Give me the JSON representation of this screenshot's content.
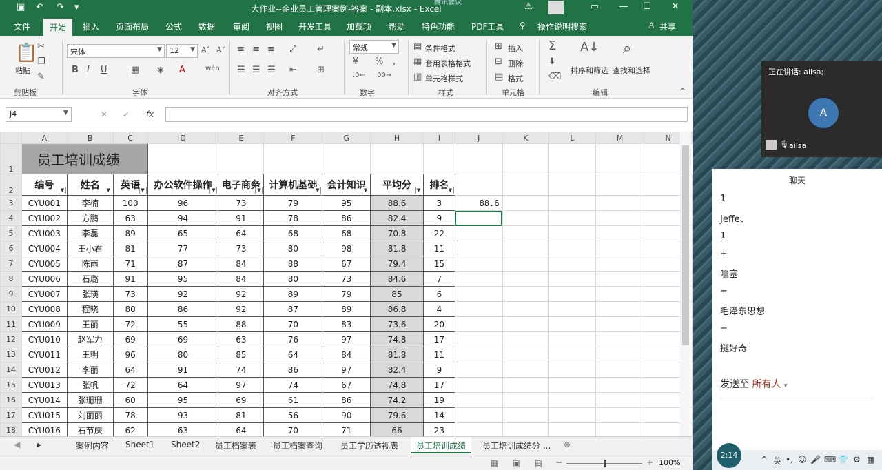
{
  "window": {
    "title": "大作业--企业员工管理案例-答案 - 副本.xlsx - Excel",
    "overlay_label": "腾讯会议"
  },
  "ribbon_tabs": [
    "文件",
    "开始",
    "插入",
    "页面布局",
    "公式",
    "数据",
    "审阅",
    "视图",
    "开发工具",
    "加载项",
    "帮助",
    "特色功能",
    "PDF工具"
  ],
  "active_tab": "开始",
  "tell_me": "操作说明搜索",
  "share_label": "共享",
  "ribbon": {
    "clipboard": {
      "label": "剪贴板",
      "paste": "粘贴"
    },
    "font": {
      "label": "字体",
      "name": "宋体",
      "size": "12"
    },
    "alignment": {
      "label": "对齐方式"
    },
    "number": {
      "label": "数字",
      "format": "常规"
    },
    "styles": {
      "label": "样式",
      "conditional": "条件格式",
      "table": "套用表格格式",
      "cell": "单元格样式"
    },
    "cells": {
      "label": "单元格",
      "insert": "插入",
      "delete": "删除",
      "format": "格式"
    },
    "editing": {
      "label": "编辑",
      "sort": "排序和筛选",
      "find": "查找和选择"
    }
  },
  "formula_bar": {
    "name_box": "J4",
    "value": ""
  },
  "columns": [
    "A",
    "B",
    "C",
    "D",
    "E",
    "F",
    "G",
    "H",
    "I",
    "J",
    "K",
    "L",
    "M",
    "N"
  ],
  "sheet": {
    "title": "员工培训成绩",
    "headers": [
      "编号",
      "姓名",
      "英语",
      "办公软件操作",
      "电子商务",
      "计算机基础",
      "会计知识",
      "平均分",
      "排名"
    ],
    "rows": [
      {
        "num": "3",
        "cells": [
          "CYU001",
          "李楠",
          "100",
          "96",
          "73",
          "79",
          "95",
          "88.6",
          "3"
        ]
      },
      {
        "num": "4",
        "cells": [
          "CYU002",
          "方鹏",
          "63",
          "94",
          "91",
          "78",
          "86",
          "82.4",
          "9"
        ]
      },
      {
        "num": "5",
        "cells": [
          "CYU003",
          "李磊",
          "89",
          "65",
          "64",
          "68",
          "68",
          "70.8",
          "22"
        ]
      },
      {
        "num": "6",
        "cells": [
          "CYU004",
          "王小君",
          "81",
          "77",
          "73",
          "80",
          "98",
          "81.8",
          "11"
        ]
      },
      {
        "num": "7",
        "cells": [
          "CYU005",
          "陈雨",
          "71",
          "87",
          "84",
          "88",
          "67",
          "79.4",
          "15"
        ]
      },
      {
        "num": "8",
        "cells": [
          "CYU006",
          "石璐",
          "91",
          "95",
          "84",
          "80",
          "73",
          "84.6",
          "7"
        ]
      },
      {
        "num": "9",
        "cells": [
          "CYU007",
          "张瑛",
          "73",
          "92",
          "92",
          "89",
          "79",
          "85",
          "6"
        ]
      },
      {
        "num": "10",
        "cells": [
          "CYU008",
          "程晓",
          "80",
          "86",
          "92",
          "87",
          "89",
          "86.8",
          "4"
        ]
      },
      {
        "num": "11",
        "cells": [
          "CYU009",
          "王丽",
          "72",
          "55",
          "88",
          "70",
          "83",
          "73.6",
          "20"
        ]
      },
      {
        "num": "12",
        "cells": [
          "CYU010",
          "赵军力",
          "69",
          "69",
          "63",
          "76",
          "97",
          "74.8",
          "17"
        ]
      },
      {
        "num": "13",
        "cells": [
          "CYU011",
          "王明",
          "96",
          "80",
          "85",
          "64",
          "84",
          "81.8",
          "11"
        ]
      },
      {
        "num": "14",
        "cells": [
          "CYU012",
          "李丽",
          "64",
          "91",
          "74",
          "86",
          "97",
          "82.4",
          "9"
        ]
      },
      {
        "num": "15",
        "cells": [
          "CYU013",
          "张帆",
          "72",
          "64",
          "97",
          "74",
          "67",
          "74.8",
          "17"
        ]
      },
      {
        "num": "16",
        "cells": [
          "CYU014",
          "张珊珊",
          "60",
          "95",
          "69",
          "61",
          "86",
          "74.2",
          "19"
        ]
      },
      {
        "num": "17",
        "cells": [
          "CYU015",
          "刘丽丽",
          "78",
          "93",
          "81",
          "56",
          "90",
          "79.6",
          "14"
        ]
      },
      {
        "num": "18",
        "cells": [
          "CYU016",
          "石节庆",
          "62",
          "63",
          "64",
          "70",
          "71",
          "66",
          "23"
        ]
      }
    ],
    "j3_value": "88.6"
  },
  "sheet_tabs": [
    "案例内容",
    "Sheet1",
    "Sheet2",
    "员工档案表",
    "员工档案查询",
    "员工学历透视表",
    "员工培训成绩",
    "员工培训成绩分 ..."
  ],
  "active_sheet": "员工培训成绩",
  "zoom": "100%",
  "meeting": {
    "speaking": "正在讲话: ailsa;",
    "avatar_letter": "A",
    "speaker": "ailsa",
    "chat_title": "聊天",
    "messages": [
      "1",
      "Jeffe、",
      "1",
      "+",
      "哇塞",
      "+",
      "毛泽东思想",
      "+",
      "挺好奇"
    ],
    "send_to_label": "发送至",
    "send_to_target": "所有人",
    "taskbar_time": "2:14",
    "ime": "英"
  }
}
